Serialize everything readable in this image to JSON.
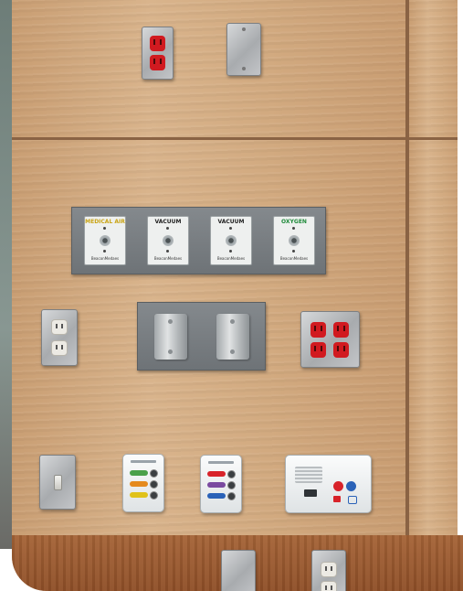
{
  "photo": {
    "subject": "medical headwall panel",
    "colors": {
      "wood": "#d2aa80",
      "baseboard": "#9a5a2f",
      "plate_steel": "#b3b6b9",
      "plate_dark": "#767b7f",
      "red_outlet": "#d11a20",
      "white_outlet": "#ecebe6"
    }
  },
  "gas_outlets": [
    {
      "label": "MEDICAL AIR",
      "label_color": "#d9b21c"
    },
    {
      "label": "VACUUM",
      "label_color": "#222222"
    },
    {
      "label": "VACUUM",
      "label_color": "#222222"
    },
    {
      "label": "OXYGEN",
      "label_color": "#1f8a3a"
    }
  ],
  "gas_brand": "BeaconMedaes",
  "alarm_panels": [
    {
      "name": "left",
      "buttons": [
        "#4aa04a",
        "#e58a1e",
        "#e0c21a"
      ]
    },
    {
      "name": "right",
      "buttons": [
        "#d8232a",
        "#7a4aa0",
        "#2a62b8"
      ]
    }
  ],
  "master_station": {
    "buttons": [
      "#d8232a",
      "#2a62b8"
    ]
  }
}
